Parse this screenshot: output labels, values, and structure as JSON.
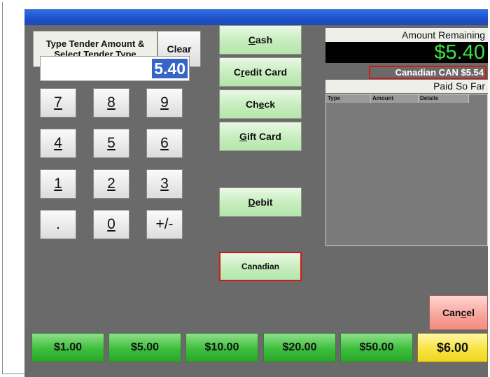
{
  "instruction": {
    "line1": "Type Tender Amount &",
    "line2": "Select Tender Type"
  },
  "clear_label": "Clear",
  "amount_input": "5.40",
  "keypad": [
    "7",
    "8",
    "9",
    "4",
    "5",
    "6",
    "1",
    "2",
    "3",
    ".",
    "0",
    "+/-"
  ],
  "tenders": {
    "cash": {
      "pre": "",
      "u": "C",
      "post": "ash"
    },
    "credit": {
      "pre": "C",
      "u": "r",
      "post": "edit Card"
    },
    "check": {
      "pre": "Ch",
      "u": "e",
      "post": "ck"
    },
    "gift": {
      "pre": "",
      "u": "G",
      "post": "ift Card"
    },
    "debit": {
      "pre": "",
      "u": "D",
      "post": "ebit"
    },
    "canadian": "Canadian"
  },
  "amount_remaining": {
    "label": "Amount Remaining",
    "value": "$5.40"
  },
  "canadian_amount": "Canadian CAN $5.54",
  "paid_so_far": {
    "label": "Paid So Far",
    "columns": [
      "Type",
      "Amount",
      "Details"
    ]
  },
  "cancel": {
    "pre": "Can",
    "u": "c",
    "post": "el"
  },
  "quick_amounts": [
    "$1.00",
    "$5.00",
    "$10.00",
    "$20.00",
    "$50.00",
    "$6.00"
  ],
  "colors": {
    "accent_green": "#3ee43e",
    "highlight_red": "#d01818",
    "selection_blue": "#3565c8",
    "exact_yellow": "#f7e443"
  }
}
